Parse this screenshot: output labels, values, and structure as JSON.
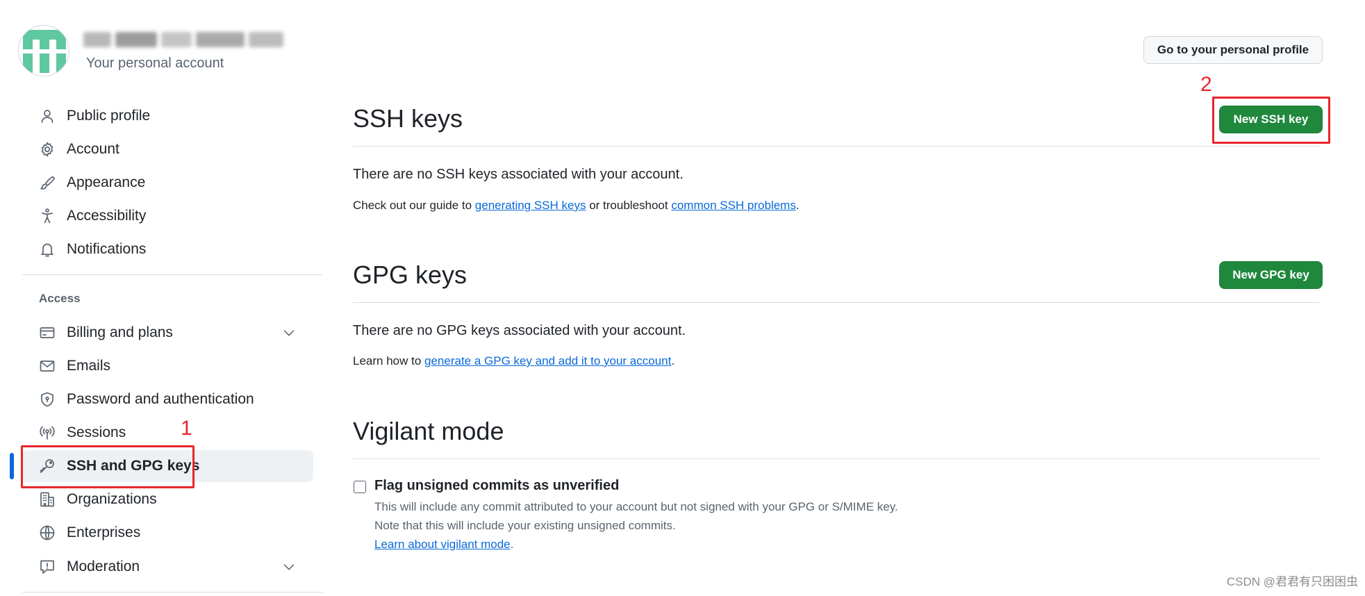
{
  "account": {
    "subtitle": "Your personal account"
  },
  "header": {
    "profile_button": "Go to your personal profile"
  },
  "sidebar": {
    "items": [
      {
        "label": "Public profile",
        "icon": "person-icon"
      },
      {
        "label": "Account",
        "icon": "gear-icon"
      },
      {
        "label": "Appearance",
        "icon": "paintbrush-icon"
      },
      {
        "label": "Accessibility",
        "icon": "accessibility-icon"
      },
      {
        "label": "Notifications",
        "icon": "bell-icon"
      }
    ],
    "access_heading": "Access",
    "access_items": [
      {
        "label": "Billing and plans",
        "icon": "credit-card-icon",
        "expandable": true
      },
      {
        "label": "Emails",
        "icon": "mail-icon"
      },
      {
        "label": "Password and authentication",
        "icon": "shield-lock-icon"
      },
      {
        "label": "Sessions",
        "icon": "broadcast-icon"
      },
      {
        "label": "SSH and GPG keys",
        "icon": "key-icon",
        "active": true
      },
      {
        "label": "Organizations",
        "icon": "organization-icon"
      },
      {
        "label": "Enterprises",
        "icon": "globe-icon"
      },
      {
        "label": "Moderation",
        "icon": "report-icon",
        "expandable": true
      }
    ]
  },
  "ssh": {
    "title": "SSH keys",
    "new_button": "New SSH key",
    "empty_text": "There are no SSH keys associated with your account.",
    "guide_prefix": "Check out our guide to ",
    "guide_link": "generating SSH keys",
    "guide_middle": " or troubleshoot ",
    "guide_link2": "common SSH problems",
    "guide_suffix": "."
  },
  "gpg": {
    "title": "GPG keys",
    "new_button": "New GPG key",
    "empty_text": "There are no GPG keys associated with your account.",
    "learn_prefix": "Learn how to ",
    "learn_link": "generate a GPG key and add it to your account",
    "learn_suffix": "."
  },
  "vigilant": {
    "title": "Vigilant mode",
    "checkbox_label": "Flag unsigned commits as unverified",
    "checked": false,
    "note1": "This will include any commit attributed to your account but not signed with your GPG or S/MIME key.",
    "note2": "Note that this will include your existing unsigned commits.",
    "learn_link": "Learn about vigilant mode",
    "learn_suffix": "."
  },
  "annotations": {
    "one": "1",
    "two": "2"
  },
  "watermark": "CSDN @君君有只困困虫",
  "colors": {
    "primary_button": "#1f883d",
    "link": "#0969da",
    "active_indicator": "#0969da",
    "annotation_red": "#e8262a"
  }
}
